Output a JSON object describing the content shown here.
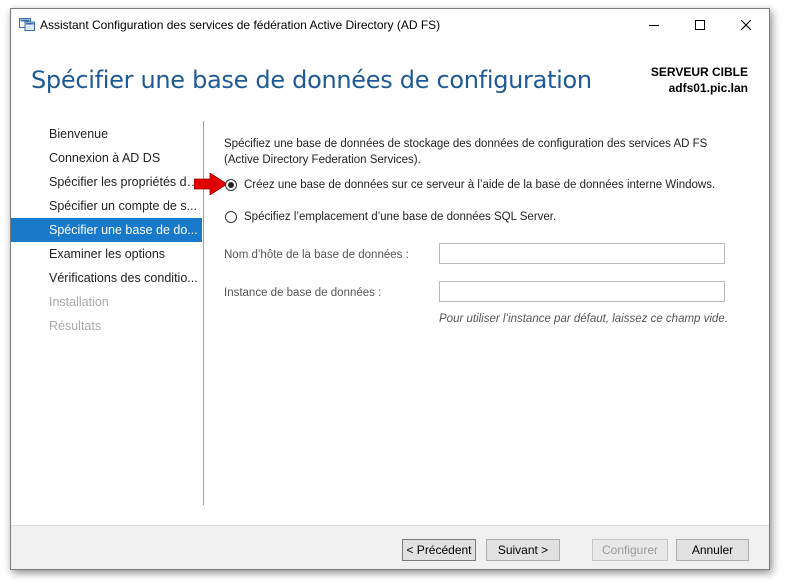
{
  "window": {
    "title": "Assistant Configuration des services de fédération Active Directory (AD FS)"
  },
  "header": {
    "page_title": "Spécifier une base de données de configuration",
    "target_label": "SERVEUR CIBLE",
    "target_server": "adfs01.pic.lan"
  },
  "nav": {
    "items": [
      {
        "label": "Bienvenue",
        "state": "normal"
      },
      {
        "label": "Connexion à AD DS",
        "state": "normal"
      },
      {
        "label": "Spécifier les propriétés de...",
        "state": "normal"
      },
      {
        "label": "Spécifier un compte de s...",
        "state": "normal"
      },
      {
        "label": "Spécifier une base de do...",
        "state": "active"
      },
      {
        "label": "Examiner les options",
        "state": "normal"
      },
      {
        "label": "Vérifications des conditio...",
        "state": "normal"
      },
      {
        "label": "Installation",
        "state": "disabled"
      },
      {
        "label": "Résultats",
        "state": "disabled"
      }
    ]
  },
  "content": {
    "description": "Spécifiez une base de données de stockage des données de configuration des services AD FS (Active Directory Federation Services).",
    "option_internal": "Créez une base de données sur ce serveur à l’aide de la base de données interne Windows.",
    "option_sql": "Spécifiez l’emplacement d’une base de données SQL Server.",
    "host_label": "Nom d’hôte de la base de données :",
    "host_value": "",
    "instance_label": "Instance de base de données :",
    "instance_value": "",
    "instance_hint": "Pour utiliser l’instance par défaut, laissez ce champ vide."
  },
  "footer": {
    "prev_label": "< Précédent",
    "next_label": "Suivant >",
    "configure_label": "Configurer",
    "cancel_label": "Annuler"
  },
  "colors": {
    "accent": "#1979ca",
    "title": "#1e5a96",
    "arrow": "#e00000"
  }
}
